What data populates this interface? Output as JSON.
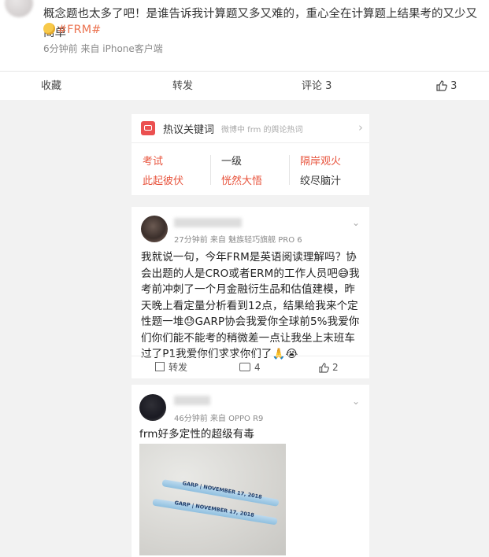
{
  "top_post": {
    "text": "概念题也太多了吧！是谁告诉我计算题又多又难的，重心全在计算题上结果考的又少又简单",
    "tag": "#FRM#",
    "meta": "6分钟前  来自 iPhone客户端",
    "actions": {
      "favorite": "收藏",
      "repost": "转发",
      "comment": "评论 3",
      "like_count": "3"
    }
  },
  "hot_keywords": {
    "title": "热议关键词",
    "subtitle": "微博中 frm 的舆论热词",
    "col1": [
      "考试",
      "此起彼伏"
    ],
    "col2": [
      "一级",
      "恍然大悟"
    ],
    "col3": [
      "隔岸观火",
      "绞尽脑汁"
    ]
  },
  "post1": {
    "meta": "27分钟前  来自 魅族轻巧旗舰 PRO 6",
    "text": "我就说一句，今年FRM是英语阅读理解吗？协会出题的人是CRO或者ERM的工作人员吧😅我考前冲刺了一个月金融衍生品和估值建模，昨天晚上看定量分析看到12点，结果给我来个定性题一堆😓GARP协会我爱你全球前5%我爱你们你们能不能考的稍微差一点让我坐上末班车过了P1我爱你们求求你们了🙏😭",
    "actions": {
      "repost": "转发",
      "comment_count": "4",
      "like_count": "2"
    }
  },
  "post2": {
    "meta": "46分钟前  来自 OPPO R9",
    "text": "frm好多定性的超级有毒",
    "pen_label": "GARP | NOVEMBER 17, 2018"
  },
  "colors": {
    "accent": "#eb7350",
    "hot": "#e8543d",
    "background": "#f2f2f2"
  }
}
